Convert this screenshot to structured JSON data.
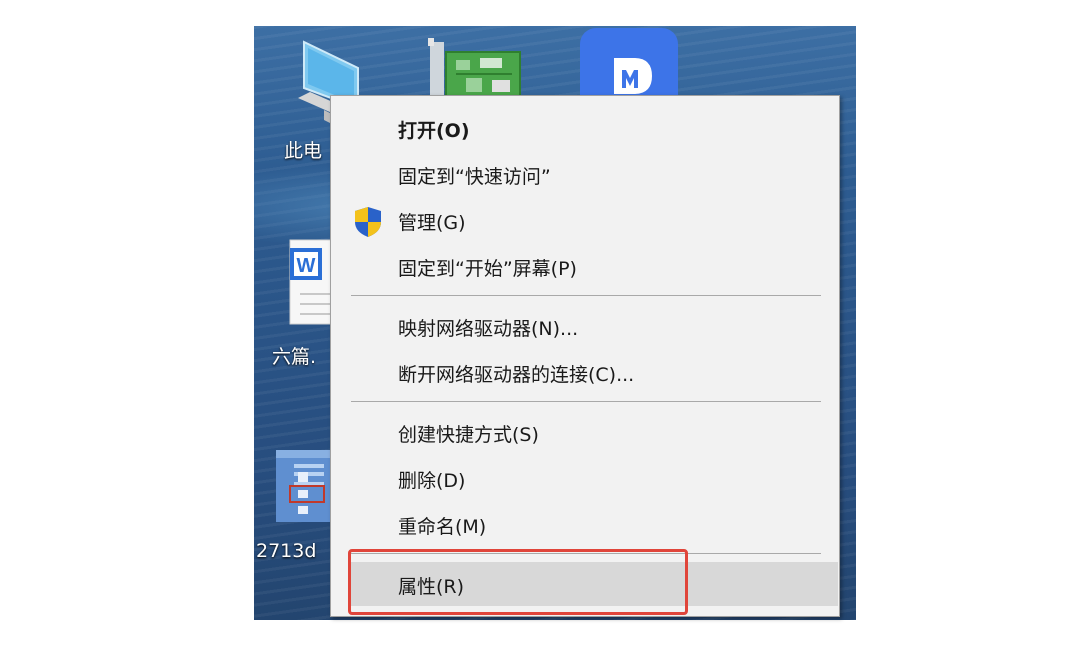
{
  "desktop": {
    "icons": [
      {
        "label": "此电",
        "icon": "this-pc-icon"
      },
      {
        "label": "",
        "icon": "circuit-board-icon"
      },
      {
        "label": "",
        "icon": "app-m-icon"
      },
      {
        "label": "六篇.",
        "icon": "word-document-icon"
      },
      {
        "label": "2713d",
        "icon": "image-thumbnail-icon"
      }
    ]
  },
  "menu": {
    "items": [
      {
        "label": "打开(O)",
        "bold": true
      },
      {
        "label": "固定到“快速访问”"
      },
      {
        "label": "管理(G)",
        "icon": "uac-shield-icon"
      },
      {
        "label": "固定到“开始”屏幕(P)"
      },
      {
        "label": "映射网络驱动器(N)..."
      },
      {
        "label": "断开网络驱动器的连接(C)..."
      },
      {
        "label": "创建快捷方式(S)"
      },
      {
        "label": "删除(D)"
      },
      {
        "label": "重命名(M)"
      },
      {
        "label": "属性(R)",
        "hovered": true,
        "highlighted": true
      }
    ]
  },
  "colors": {
    "highlight_border": "#e0453a",
    "menu_bg": "#f2f2f2",
    "hover_bg": "#d8d8d8"
  }
}
